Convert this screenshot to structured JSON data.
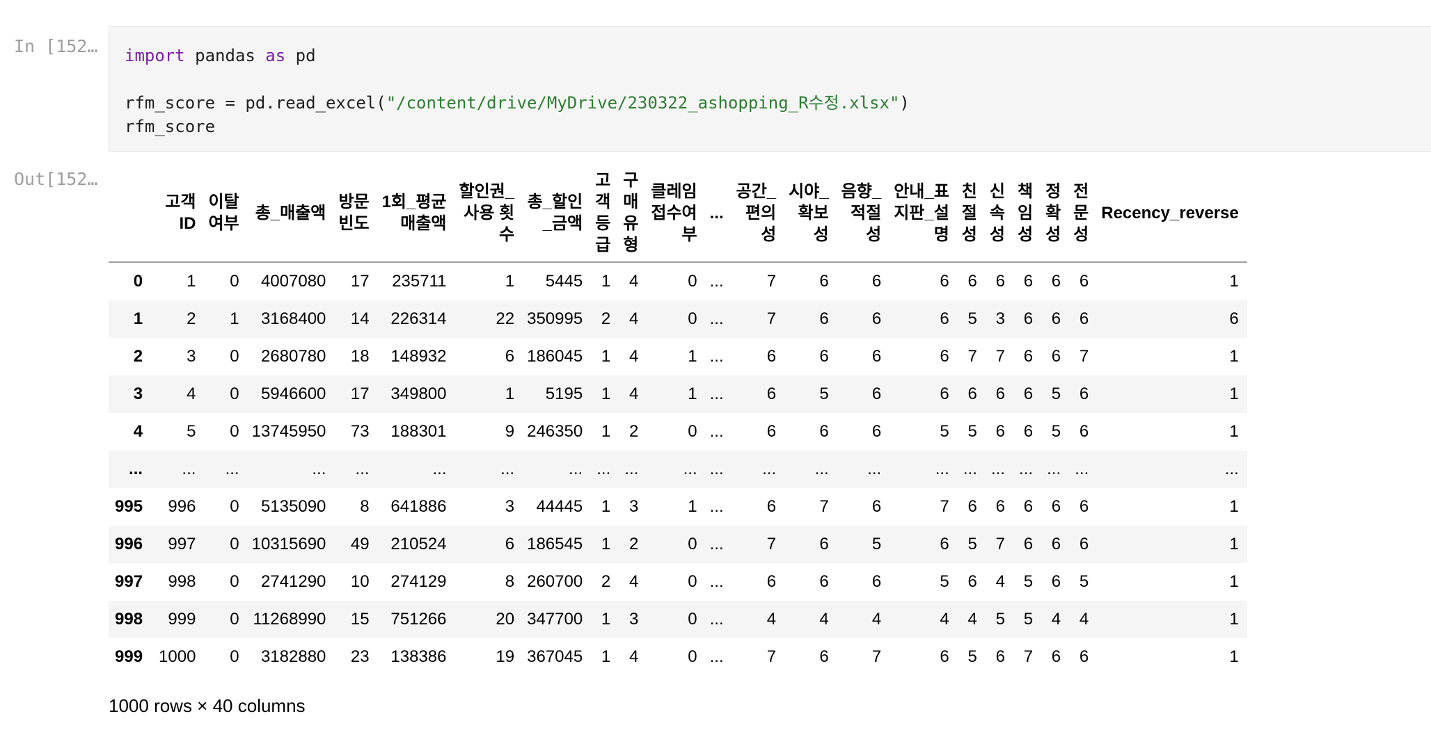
{
  "cell": {
    "input_prompt": "In [152…",
    "output_prompt": "Out[152…",
    "code": {
      "line1_kw_import": "import",
      "line1_mid": " pandas ",
      "line1_kw_as": "as",
      "line1_end": " pd",
      "line3_start": "rfm_score = pd.read_excel(",
      "line3_str": "\"/content/drive/MyDrive/230322_ashopping_R수정.xlsx\"",
      "line3_end": ")",
      "line4": "rfm_score"
    }
  },
  "dataframe": {
    "columns": [
      "",
      "고객\nID",
      "이탈\n여부",
      "총_매출액",
      "방문\n빈도",
      "1회_평균\n매출액",
      "할인권_\n사용 횟\n수",
      "총_할인\n_금액",
      "고\n객\n등\n급",
      "구\n매\n유\n형",
      "클레임\n접수여\n부",
      "...",
      "공간_\n편의\n성",
      "시야_\n확보\n성",
      "음향_\n적절\n성",
      "안내_표\n지판_설\n명",
      "친\n절\n성",
      "신\n속\n성",
      "책\n임\n성",
      "정\n확\n성",
      "전\n문\n성",
      "Recency_reverse"
    ],
    "rows": [
      [
        "0",
        "1",
        "0",
        "4007080",
        "17",
        "235711",
        "1",
        "5445",
        "1",
        "4",
        "0",
        "...",
        "7",
        "6",
        "6",
        "6",
        "6",
        "6",
        "6",
        "6",
        "6",
        "1"
      ],
      [
        "1",
        "2",
        "1",
        "3168400",
        "14",
        "226314",
        "22",
        "350995",
        "2",
        "4",
        "0",
        "...",
        "7",
        "6",
        "6",
        "6",
        "5",
        "3",
        "6",
        "6",
        "6",
        "6"
      ],
      [
        "2",
        "3",
        "0",
        "2680780",
        "18",
        "148932",
        "6",
        "186045",
        "1",
        "4",
        "1",
        "...",
        "6",
        "6",
        "6",
        "6",
        "7",
        "7",
        "6",
        "6",
        "7",
        "1"
      ],
      [
        "3",
        "4",
        "0",
        "5946600",
        "17",
        "349800",
        "1",
        "5195",
        "1",
        "4",
        "1",
        "...",
        "6",
        "5",
        "6",
        "6",
        "6",
        "6",
        "6",
        "5",
        "6",
        "1"
      ],
      [
        "4",
        "5",
        "0",
        "13745950",
        "73",
        "188301",
        "9",
        "246350",
        "1",
        "2",
        "0",
        "...",
        "6",
        "6",
        "6",
        "5",
        "5",
        "6",
        "6",
        "5",
        "6",
        "1"
      ],
      [
        "...",
        "...",
        "...",
        "...",
        "...",
        "...",
        "...",
        "...",
        "...",
        "...",
        "...",
        "...",
        "...",
        "...",
        "...",
        "...",
        "...",
        "...",
        "...",
        "...",
        "...",
        "..."
      ],
      [
        "995",
        "996",
        "0",
        "5135090",
        "8",
        "641886",
        "3",
        "44445",
        "1",
        "3",
        "1",
        "...",
        "6",
        "7",
        "6",
        "7",
        "6",
        "6",
        "6",
        "6",
        "6",
        "1"
      ],
      [
        "996",
        "997",
        "0",
        "10315690",
        "49",
        "210524",
        "6",
        "186545",
        "1",
        "2",
        "0",
        "...",
        "7",
        "6",
        "5",
        "6",
        "5",
        "7",
        "6",
        "6",
        "6",
        "1"
      ],
      [
        "997",
        "998",
        "0",
        "2741290",
        "10",
        "274129",
        "8",
        "260700",
        "2",
        "4",
        "0",
        "...",
        "6",
        "6",
        "6",
        "5",
        "6",
        "4",
        "5",
        "6",
        "5",
        "1"
      ],
      [
        "998",
        "999",
        "0",
        "11268990",
        "15",
        "751266",
        "20",
        "347700",
        "1",
        "3",
        "0",
        "...",
        "4",
        "4",
        "4",
        "4",
        "4",
        "5",
        "5",
        "4",
        "4",
        "1"
      ],
      [
        "999",
        "1000",
        "0",
        "3182880",
        "23",
        "138386",
        "19",
        "367045",
        "1",
        "4",
        "0",
        "...",
        "7",
        "6",
        "7",
        "6",
        "5",
        "6",
        "7",
        "6",
        "6",
        "1"
      ]
    ],
    "shape_text": "1000 rows × 40 columns"
  },
  "colors": {
    "prompt": "#9e9e9e",
    "input_bg": "#f5f5f5",
    "keyword": "#7b1fa2",
    "string": "#2e7d32",
    "stripe": "#f5f5f5"
  }
}
